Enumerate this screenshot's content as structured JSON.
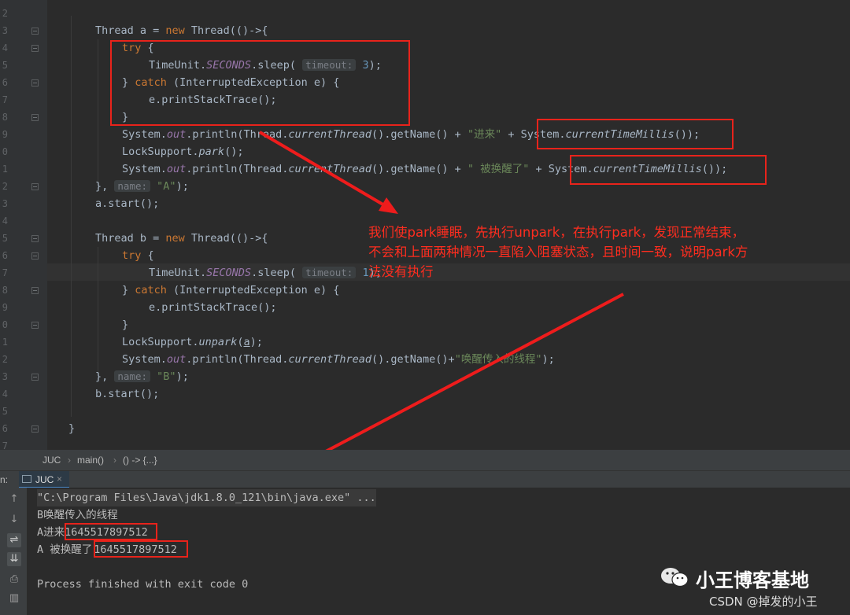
{
  "editor": {
    "line_numbers": [
      "2",
      "3",
      "4",
      "5",
      "6",
      "7",
      "8",
      "9",
      "0",
      "1",
      "2",
      "3",
      "4",
      "5",
      "6",
      "7",
      "8",
      "9",
      "0",
      "1",
      "2",
      "3",
      "4",
      "5",
      "6",
      "7"
    ],
    "code": {
      "thread_a": {
        "decl": "Thread a = ",
        "kw_new": "new",
        "cls": " Thread(()->{"
      },
      "try_kw": "try",
      "brace_open": " {",
      "sleep_pre": "TimeUnit.",
      "sleep_field": "SECONDS",
      "sleep_call": ".sleep(",
      "timeout_hint": "timeout:",
      "sleep_arg_a": "3",
      "sleep_end": ");",
      "catch_close": "} ",
      "catch_kw": "catch",
      "catch_rest": " (InterruptedException e) {",
      "print_trace": "e.printStackTrace();",
      "brace_close": "}",
      "println_pre": "System.",
      "out_field": "out",
      "println_call": ".println(Thread.",
      "current_thread": "currentThread",
      "get_name": "().getName() + ",
      "str_enter": "\"进来\"",
      "plus": " + ",
      "millis_pre": "System.",
      "millis_call": "currentTimeMillis",
      "millis_end": "());",
      "park_pre": "LockSupport.",
      "park_call": "park",
      "park_end": "();",
      "str_woken": "\" 被换醒了\"",
      "closing_pre": "}, ",
      "name_hint": "name:",
      "name_a": "\"A\"",
      "closing_end": ");",
      "a_start": "a.start();",
      "thread_b": {
        "decl": "Thread b = ",
        "kw_new": "new",
        "cls": " Thread(()->{"
      },
      "sleep_arg_b": "1",
      "unpark_pre": "LockSupport.",
      "unpark_call": "unpark",
      "unpark_open": "(",
      "unpark_arg": "a",
      "unpark_end": ");",
      "get_name_b": "().getName()+",
      "str_b_msg": "\"唤醒传入的线程\"",
      "println_end": ");",
      "name_b": "\"B\"",
      "b_start": "b.start();",
      "class_close": "}"
    },
    "annotation": "我们使park睡眠，先执行unpark，在执行park，发现正常结束，\n不会和上面两种情况一直陷入阻塞状态，且时间一致，说明park方\n法没有执行"
  },
  "breadcrumb": {
    "items": [
      "JUC",
      "main()",
      "() -> {...}"
    ],
    "separator": "›"
  },
  "run_panel": {
    "prefix": "n:",
    "tab_label": "JUC",
    "close_glyph": "×"
  },
  "console": {
    "lines": [
      "\"C:\\Program Files\\Java\\jdk1.8.0_121\\bin\\java.exe\" ...",
      "B唤醒传入的线程",
      "A进来",
      "A 被换醒了",
      "",
      "Process finished with exit code 0"
    ],
    "timestamp_1": "1645517897512",
    "timestamp_2": "1645517897512"
  },
  "watermark": {
    "brand": "小王博客基地",
    "csdn": "CSDN @掉发的小王"
  },
  "colors": {
    "annotation": "#ff2d1f",
    "box": "#e8231b",
    "keyword": "#cc7832",
    "string": "#6a8759",
    "field": "#9876aa"
  }
}
